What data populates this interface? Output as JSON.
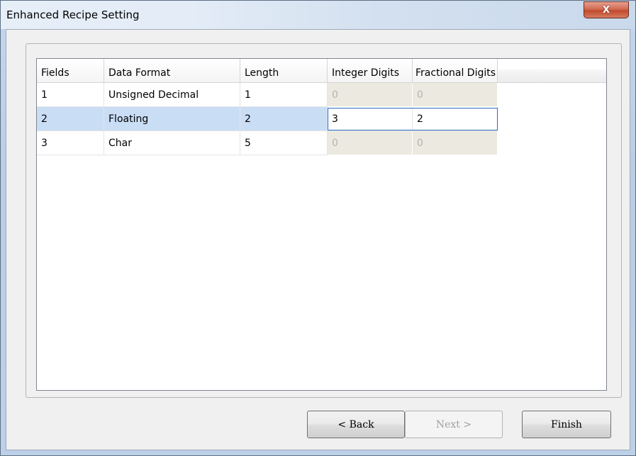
{
  "window": {
    "title": "Enhanced Recipe Setting",
    "close_glyph": "X"
  },
  "grid": {
    "columns": [
      "Fields",
      "Data Format",
      "Length",
      "Integer Digits",
      "Fractional Digits"
    ],
    "rows": [
      {
        "field": "1",
        "data_format": "Unsigned Decimal",
        "length": "1",
        "integer_digits": "0",
        "fractional_digits": "0",
        "digits_enabled": false
      },
      {
        "field": "2",
        "data_format": "Floating",
        "length": "2",
        "integer_digits": "3",
        "fractional_digits": "2",
        "digits_enabled": true,
        "selected": true
      },
      {
        "field": "3",
        "data_format": "Char",
        "length": "5",
        "integer_digits": "0",
        "fractional_digits": "0",
        "digits_enabled": false
      }
    ]
  },
  "buttons": {
    "back_label": "< Back",
    "next_label": "Next >",
    "finish_label": "Finish"
  }
}
